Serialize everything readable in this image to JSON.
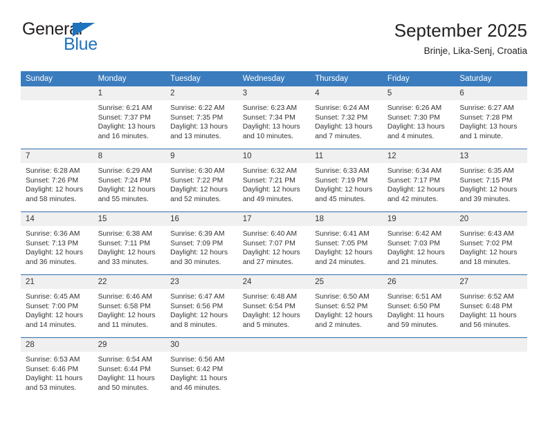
{
  "brand": {
    "line1": "General",
    "line2": "Blue",
    "triangle_color": "#1f72bd"
  },
  "header": {
    "title": "September 2025",
    "subtitle": "Brinje, Lika-Senj, Croatia",
    "header_bg": "#3a7cbe",
    "header_text_color": "#ffffff"
  },
  "weekdays": [
    "Sunday",
    "Monday",
    "Tuesday",
    "Wednesday",
    "Thursday",
    "Friday",
    "Saturday"
  ],
  "weeks": [
    [
      {
        "day": "",
        "sunrise": "",
        "sunset": "",
        "daylight_1": "",
        "daylight_2": ""
      },
      {
        "day": "1",
        "sunrise": "Sunrise: 6:21 AM",
        "sunset": "Sunset: 7:37 PM",
        "daylight_1": "Daylight: 13 hours",
        "daylight_2": "and 16 minutes."
      },
      {
        "day": "2",
        "sunrise": "Sunrise: 6:22 AM",
        "sunset": "Sunset: 7:35 PM",
        "daylight_1": "Daylight: 13 hours",
        "daylight_2": "and 13 minutes."
      },
      {
        "day": "3",
        "sunrise": "Sunrise: 6:23 AM",
        "sunset": "Sunset: 7:34 PM",
        "daylight_1": "Daylight: 13 hours",
        "daylight_2": "and 10 minutes."
      },
      {
        "day": "4",
        "sunrise": "Sunrise: 6:24 AM",
        "sunset": "Sunset: 7:32 PM",
        "daylight_1": "Daylight: 13 hours",
        "daylight_2": "and 7 minutes."
      },
      {
        "day": "5",
        "sunrise": "Sunrise: 6:26 AM",
        "sunset": "Sunset: 7:30 PM",
        "daylight_1": "Daylight: 13 hours",
        "daylight_2": "and 4 minutes."
      },
      {
        "day": "6",
        "sunrise": "Sunrise: 6:27 AM",
        "sunset": "Sunset: 7:28 PM",
        "daylight_1": "Daylight: 13 hours",
        "daylight_2": "and 1 minute."
      }
    ],
    [
      {
        "day": "7",
        "sunrise": "Sunrise: 6:28 AM",
        "sunset": "Sunset: 7:26 PM",
        "daylight_1": "Daylight: 12 hours",
        "daylight_2": "and 58 minutes."
      },
      {
        "day": "8",
        "sunrise": "Sunrise: 6:29 AM",
        "sunset": "Sunset: 7:24 PM",
        "daylight_1": "Daylight: 12 hours",
        "daylight_2": "and 55 minutes."
      },
      {
        "day": "9",
        "sunrise": "Sunrise: 6:30 AM",
        "sunset": "Sunset: 7:22 PM",
        "daylight_1": "Daylight: 12 hours",
        "daylight_2": "and 52 minutes."
      },
      {
        "day": "10",
        "sunrise": "Sunrise: 6:32 AM",
        "sunset": "Sunset: 7:21 PM",
        "daylight_1": "Daylight: 12 hours",
        "daylight_2": "and 49 minutes."
      },
      {
        "day": "11",
        "sunrise": "Sunrise: 6:33 AM",
        "sunset": "Sunset: 7:19 PM",
        "daylight_1": "Daylight: 12 hours",
        "daylight_2": "and 45 minutes."
      },
      {
        "day": "12",
        "sunrise": "Sunrise: 6:34 AM",
        "sunset": "Sunset: 7:17 PM",
        "daylight_1": "Daylight: 12 hours",
        "daylight_2": "and 42 minutes."
      },
      {
        "day": "13",
        "sunrise": "Sunrise: 6:35 AM",
        "sunset": "Sunset: 7:15 PM",
        "daylight_1": "Daylight: 12 hours",
        "daylight_2": "and 39 minutes."
      }
    ],
    [
      {
        "day": "14",
        "sunrise": "Sunrise: 6:36 AM",
        "sunset": "Sunset: 7:13 PM",
        "daylight_1": "Daylight: 12 hours",
        "daylight_2": "and 36 minutes."
      },
      {
        "day": "15",
        "sunrise": "Sunrise: 6:38 AM",
        "sunset": "Sunset: 7:11 PM",
        "daylight_1": "Daylight: 12 hours",
        "daylight_2": "and 33 minutes."
      },
      {
        "day": "16",
        "sunrise": "Sunrise: 6:39 AM",
        "sunset": "Sunset: 7:09 PM",
        "daylight_1": "Daylight: 12 hours",
        "daylight_2": "and 30 minutes."
      },
      {
        "day": "17",
        "sunrise": "Sunrise: 6:40 AM",
        "sunset": "Sunset: 7:07 PM",
        "daylight_1": "Daylight: 12 hours",
        "daylight_2": "and 27 minutes."
      },
      {
        "day": "18",
        "sunrise": "Sunrise: 6:41 AM",
        "sunset": "Sunset: 7:05 PM",
        "daylight_1": "Daylight: 12 hours",
        "daylight_2": "and 24 minutes."
      },
      {
        "day": "19",
        "sunrise": "Sunrise: 6:42 AM",
        "sunset": "Sunset: 7:03 PM",
        "daylight_1": "Daylight: 12 hours",
        "daylight_2": "and 21 minutes."
      },
      {
        "day": "20",
        "sunrise": "Sunrise: 6:43 AM",
        "sunset": "Sunset: 7:02 PM",
        "daylight_1": "Daylight: 12 hours",
        "daylight_2": "and 18 minutes."
      }
    ],
    [
      {
        "day": "21",
        "sunrise": "Sunrise: 6:45 AM",
        "sunset": "Sunset: 7:00 PM",
        "daylight_1": "Daylight: 12 hours",
        "daylight_2": "and 14 minutes."
      },
      {
        "day": "22",
        "sunrise": "Sunrise: 6:46 AM",
        "sunset": "Sunset: 6:58 PM",
        "daylight_1": "Daylight: 12 hours",
        "daylight_2": "and 11 minutes."
      },
      {
        "day": "23",
        "sunrise": "Sunrise: 6:47 AM",
        "sunset": "Sunset: 6:56 PM",
        "daylight_1": "Daylight: 12 hours",
        "daylight_2": "and 8 minutes."
      },
      {
        "day": "24",
        "sunrise": "Sunrise: 6:48 AM",
        "sunset": "Sunset: 6:54 PM",
        "daylight_1": "Daylight: 12 hours",
        "daylight_2": "and 5 minutes."
      },
      {
        "day": "25",
        "sunrise": "Sunrise: 6:50 AM",
        "sunset": "Sunset: 6:52 PM",
        "daylight_1": "Daylight: 12 hours",
        "daylight_2": "and 2 minutes."
      },
      {
        "day": "26",
        "sunrise": "Sunrise: 6:51 AM",
        "sunset": "Sunset: 6:50 PM",
        "daylight_1": "Daylight: 11 hours",
        "daylight_2": "and 59 minutes."
      },
      {
        "day": "27",
        "sunrise": "Sunrise: 6:52 AM",
        "sunset": "Sunset: 6:48 PM",
        "daylight_1": "Daylight: 11 hours",
        "daylight_2": "and 56 minutes."
      }
    ],
    [
      {
        "day": "28",
        "sunrise": "Sunrise: 6:53 AM",
        "sunset": "Sunset: 6:46 PM",
        "daylight_1": "Daylight: 11 hours",
        "daylight_2": "and 53 minutes."
      },
      {
        "day": "29",
        "sunrise": "Sunrise: 6:54 AM",
        "sunset": "Sunset: 6:44 PM",
        "daylight_1": "Daylight: 11 hours",
        "daylight_2": "and 50 minutes."
      },
      {
        "day": "30",
        "sunrise": "Sunrise: 6:56 AM",
        "sunset": "Sunset: 6:42 PM",
        "daylight_1": "Daylight: 11 hours",
        "daylight_2": "and 46 minutes."
      },
      {
        "day": "",
        "sunrise": "",
        "sunset": "",
        "daylight_1": "",
        "daylight_2": ""
      },
      {
        "day": "",
        "sunrise": "",
        "sunset": "",
        "daylight_1": "",
        "daylight_2": ""
      },
      {
        "day": "",
        "sunrise": "",
        "sunset": "",
        "daylight_1": "",
        "daylight_2": ""
      },
      {
        "day": "",
        "sunrise": "",
        "sunset": "",
        "daylight_1": "",
        "daylight_2": ""
      }
    ]
  ]
}
